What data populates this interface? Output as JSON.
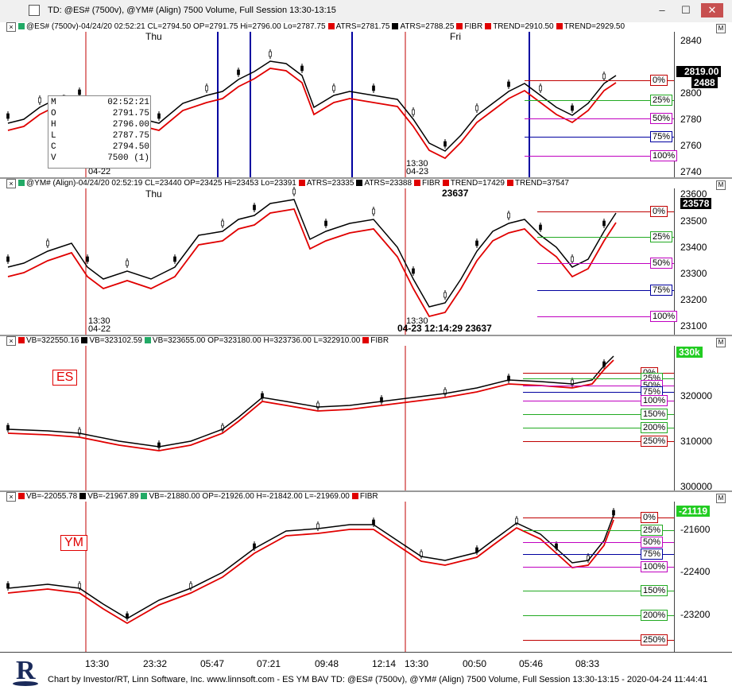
{
  "window": {
    "title": "TD: @ES# (7500v), @YM# (Align) 7500 Volume, Full Session 13:30-13:15",
    "minimize": "–",
    "maximize": "☐",
    "close": "✕"
  },
  "panes": [
    {
      "header": [
        {
          "text": "@ES# (7500v)-04/24/20 02:52:21 CL=2794.50 OP=2791.75 Hi=2796.00 Lo=2787.75",
          "color": "#000000",
          "swatch": "#2a6"
        },
        {
          "text": "ATRS=2781.75",
          "swatch": "#e00000"
        },
        {
          "text": "ATRS=2788.25",
          "swatch": "#000000"
        },
        {
          "text": "FIBR",
          "swatch": "#e00000"
        },
        {
          "text": "TREND=2910.50",
          "swatch": "#e00000"
        },
        {
          "text": "TREND=2929.50",
          "swatch": "#e00000"
        }
      ],
      "axis": [
        "2840",
        "2820",
        "2800",
        "2780",
        "2760",
        "2740"
      ],
      "price_box": "2819.00",
      "price_box2": "2488",
      "fibs": [
        "0%",
        "25%",
        "50%",
        "75%",
        "100%"
      ],
      "days": [
        "Thu",
        "Fri"
      ],
      "datestamps": [
        "04-22",
        "13:30",
        "04-23"
      ]
    },
    {
      "header": [
        {
          "text": "@YM# (Align)-04/24/20 02:52:19 CL=23440 OP=23425 Hi=23453 Lo=23391",
          "swatch": "#2a6"
        },
        {
          "text": "ATRS=23335",
          "swatch": "#e00000"
        },
        {
          "text": "ATRS=23388",
          "swatch": "#000000"
        },
        {
          "text": "FIBR",
          "swatch": "#e00000"
        },
        {
          "text": "TREND=17429",
          "swatch": "#e00000"
        },
        {
          "text": "TREND=37547",
          "swatch": "#e00000"
        }
      ],
      "axis": [
        "23600",
        "23500",
        "23400",
        "23300",
        "23200",
        "23100"
      ],
      "price_box": "23578",
      "fibs": [
        "0%",
        "25%",
        "50%",
        "75%",
        "100%"
      ],
      "days": [
        "Thu"
      ],
      "datestamps": [
        "13:30",
        "04-22",
        "13:30",
        "04-23"
      ],
      "annot_top": "23637",
      "annot_bottom": "04-23 12:14:29 23637"
    },
    {
      "header": [
        {
          "text": "VB=322550.16",
          "swatch": "#e00000"
        },
        {
          "text": "VB=323102.59",
          "swatch": "#000000"
        },
        {
          "text": "VB=323655.00 OP=323180.00 H=323736.00 L=322910.00",
          "swatch": "#2a6"
        },
        {
          "text": "FIBR",
          "swatch": "#e00000"
        }
      ],
      "axis": [
        "320000",
        "310000",
        "300000"
      ],
      "price_box": "330k",
      "tag": "ES",
      "fibs": [
        "0%",
        "25%",
        "50%",
        "75%",
        "100%",
        "150%",
        "200%",
        "250%"
      ]
    },
    {
      "header": [
        {
          "text": "VB=-22055.78",
          "swatch": "#e00000"
        },
        {
          "text": "VB=-21967.89",
          "swatch": "#000000"
        },
        {
          "text": "VB=-21880.00 OP=-21926.00 H=-21842.00 L=-21969.00",
          "swatch": "#2a6"
        },
        {
          "text": "FIBR",
          "swatch": "#e00000"
        }
      ],
      "axis": [
        "-21600",
        "-22400",
        "-23200"
      ],
      "price_box": "-21119",
      "tag": "YM",
      "fibs": [
        "0%",
        "25%",
        "50%",
        "75%",
        "100%",
        "150%",
        "200%",
        "250%"
      ]
    }
  ],
  "ohlc_popup": {
    "rows": [
      {
        "k": "M",
        "v": "02:52:21"
      },
      {
        "k": "O",
        "v": "2791.75"
      },
      {
        "k": "H",
        "v": "2796.00"
      },
      {
        "k": "L",
        "v": "2787.75"
      },
      {
        "k": "C",
        "v": "2794.50"
      },
      {
        "k": "V",
        "v": "7500 (1)"
      }
    ]
  },
  "x_axis": [
    "13:30",
    "23:32",
    "05:47",
    "07:21",
    "09:48",
    "12:14",
    "13:30",
    "00:50",
    "05:46",
    "08:33"
  ],
  "footer": "Chart by Investor/RT, Linn Software, Inc. www.linnsoft.com - ES YM BAV TD: @ES# (7500v), @YM# (Align) 7500 Volume, Full Session 13:30-13:15 - 2020-04-24 11:44:41",
  "colors": {
    "trend_red": "#e00000",
    "trend_black": "#000000",
    "fib0": "#c00000",
    "fib25": "#22aa22",
    "fib50": "#c000c0",
    "fib75": "#0000a0",
    "fib100": "#c000c0",
    "fib150": "#22aa22",
    "fib200": "#22aa22",
    "fib250": "#c00000",
    "session_line": "#c00000",
    "marker_blue": "#0000a0"
  }
}
